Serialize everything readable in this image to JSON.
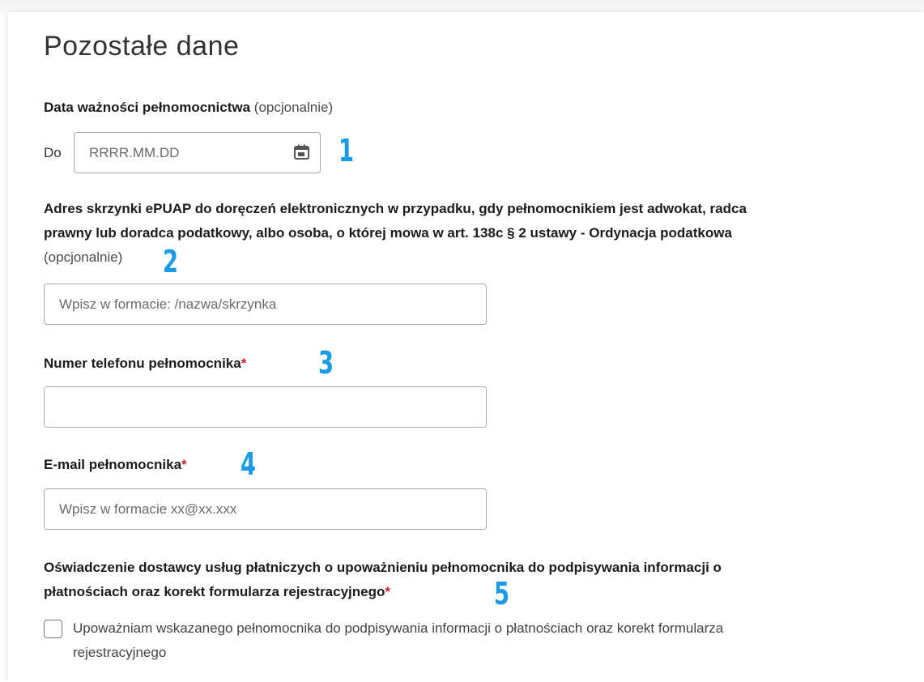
{
  "page": {
    "title": "Pozostałe dane"
  },
  "validity_date": {
    "label": "Data ważności pełnomocnictwa",
    "optional": "(opcjonalnie)",
    "prefix": "Do",
    "placeholder": "RRRR.MM.DD",
    "icon": "calendar-icon"
  },
  "epuap": {
    "label_line1": "Adres skrzynki ePUAP do doręczeń elektronicznych w przypadku, gdy pełnomocnikiem jest adwokat, radca",
    "label_line2": "prawny lub doradca podatkowy, albo osoba, o której mowa w art. 138c § 2 ustawy - Ordynacja podatkowa",
    "optional": "(opcjonalnie)",
    "placeholder": "Wpisz w formacie: /nazwa/skrzynka"
  },
  "phone": {
    "label": "Numer telefonu pełnomocnika",
    "required_mark": "*",
    "value": ""
  },
  "email": {
    "label": "E-mail pełnomocnika",
    "required_mark": "*",
    "placeholder": "Wpisz w formacie xx@xx.xxx"
  },
  "statement": {
    "label_line1": "Oświadczenie dostawcy usług płatniczych o upoważnieniu pełnomocnika do podpisywania informacji o",
    "label_line2": "płatnościach oraz korekt formularza rejestracyjnego",
    "required_mark": "*",
    "checkbox_line1": "Upoważniam wskazanego pełnomocnika do podpisywania informacji o płatnościach oraz korekt formularza",
    "checkbox_line2": "rejestracyjnego",
    "checked": false
  },
  "markers": [
    "1",
    "2",
    "3",
    "4",
    "5"
  ],
  "colors": {
    "marker": "#1a9be6",
    "required": "#c0262d",
    "border": "#a9a9a9"
  }
}
